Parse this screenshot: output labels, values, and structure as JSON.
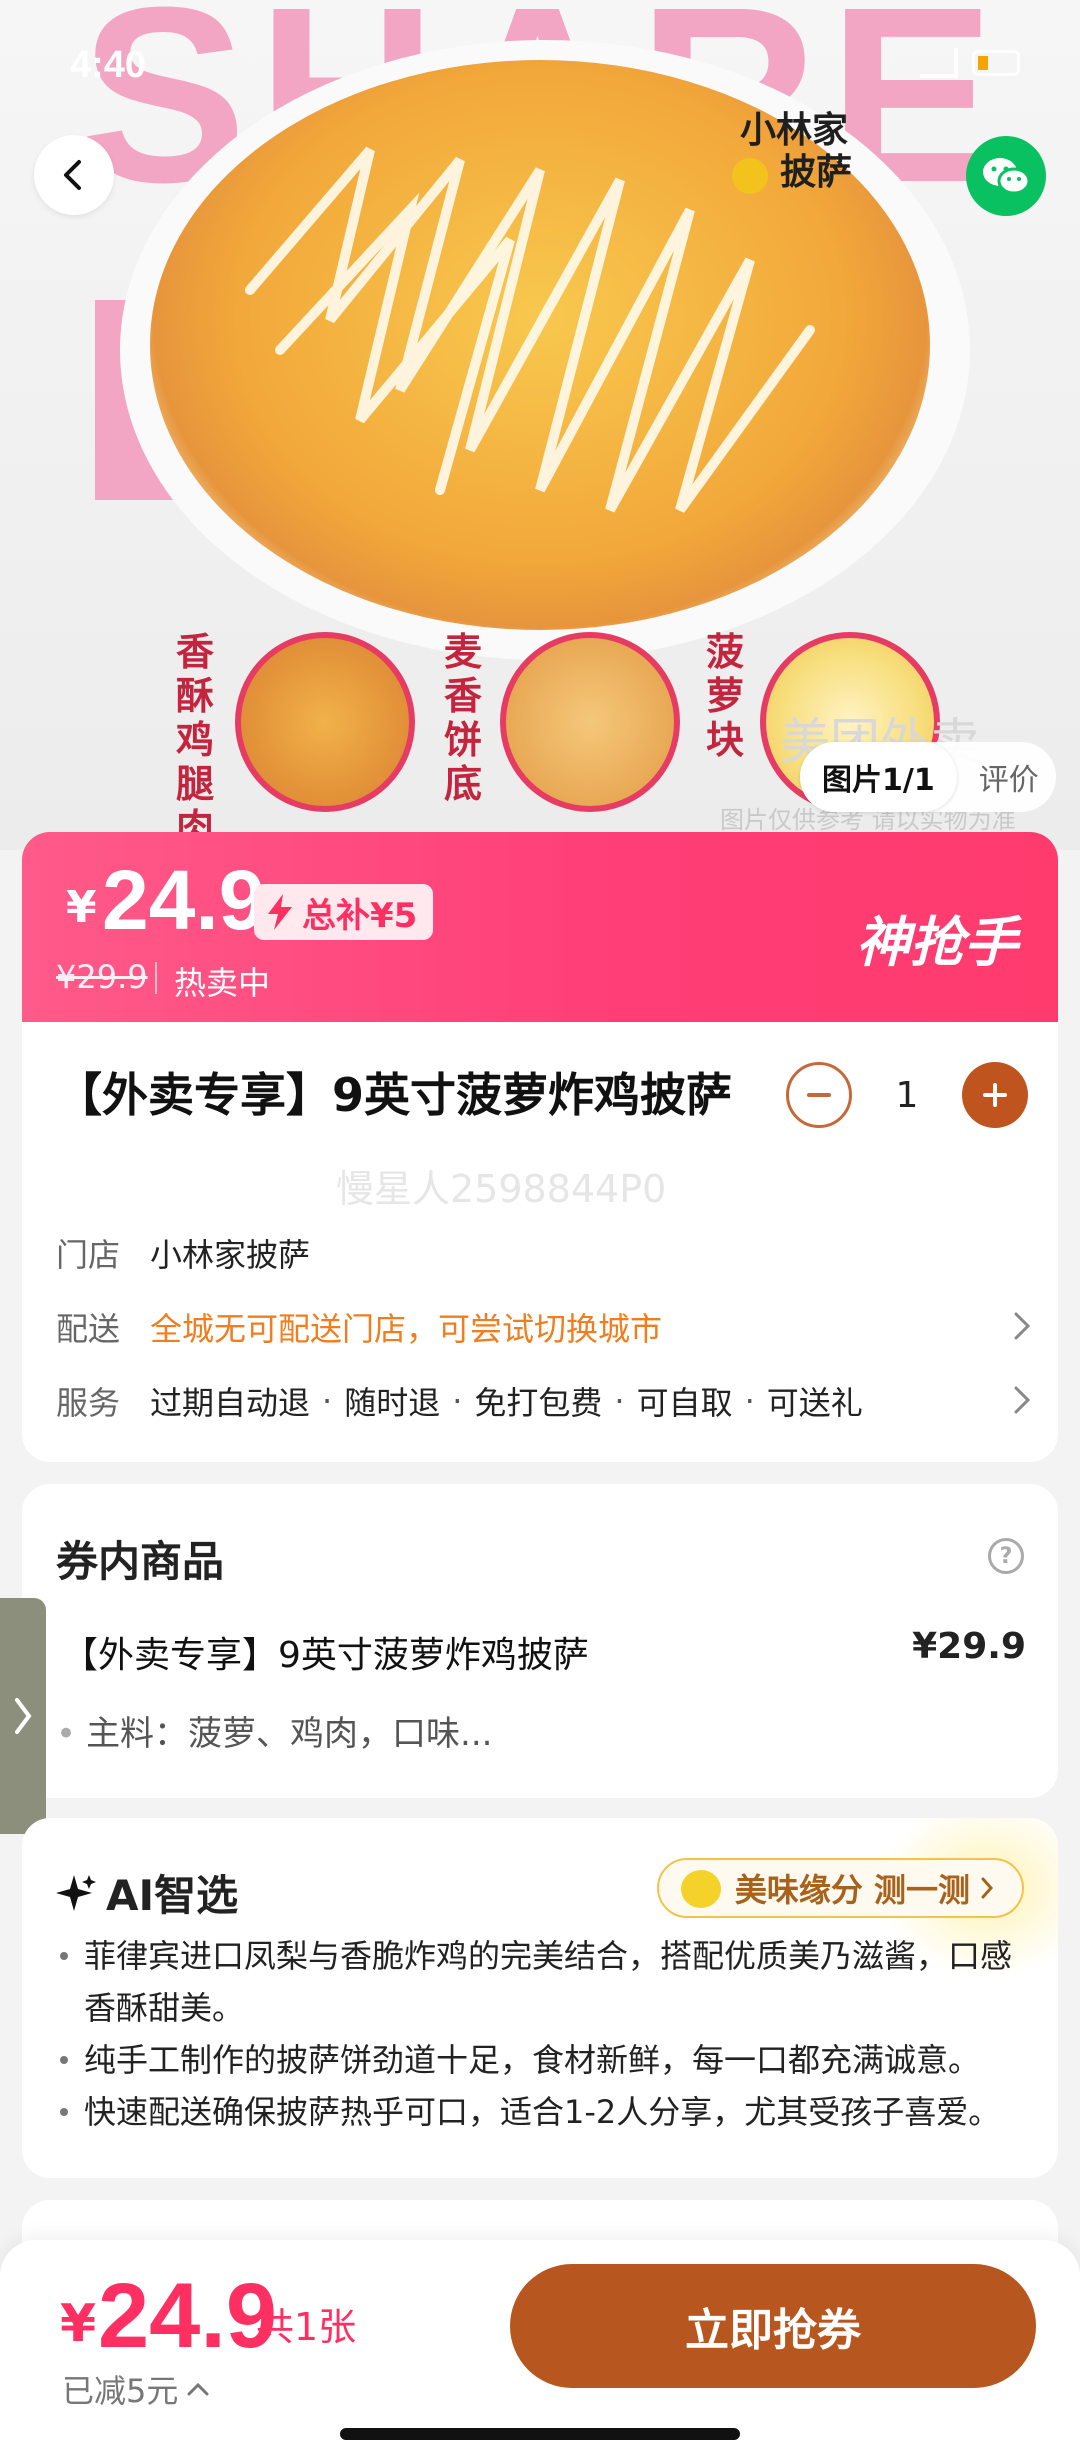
{
  "status_bar": {
    "time": "4:40"
  },
  "hero": {
    "background_word": "SHARE",
    "brand_line1": "小林家",
    "brand_line2": "披萨",
    "ingredients": [
      {
        "label": "香酥鸡腿肉"
      },
      {
        "label": "麦香饼底"
      },
      {
        "label": "菠萝块"
      }
    ],
    "image_counter": "图片1/1",
    "review_tab": "评价",
    "watermark_big": "美团外卖",
    "watermark_small": "图片仅供参考 请以实物为准"
  },
  "price": {
    "yen": "¥",
    "current": "24.9",
    "subsidy": "总补¥5",
    "original": "¥29.9",
    "status": "热卖中",
    "brand": "神抢手"
  },
  "product": {
    "title": "【外卖专享】9英寸菠萝炸鸡披萨",
    "quantity": "1",
    "watermark": "慢星人2598844P0",
    "store_key": "门店",
    "store_val": "小林家披萨",
    "delivery_key": "配送",
    "delivery_val": "全城无可配送门店，可尝试切换城市",
    "service_key": "服务",
    "services": [
      "过期自动退",
      "随时退",
      "免打包费",
      "可自取",
      "可送礼"
    ]
  },
  "coupon_items": {
    "title": "券内商品",
    "help": "?",
    "item_name": "【外卖专享】9英寸菠萝炸鸡披萨",
    "item_price": "¥29.9",
    "item_desc": "主料：菠萝、鸡肉，口味..."
  },
  "ai": {
    "title": "AI智选",
    "pill": "美味缘分 测一测",
    "bullets": [
      "菲律宾进口凤梨与香脆炸鸡的完美结合，搭配优质美乃滋酱，口感香酥甜美。",
      "纯手工制作的披萨饼劲道十足，食材新鲜，每一口都充满诚意。",
      "快速配送确保披萨热乎可口，适合1-2人分享，尤其受孩子喜爱。"
    ]
  },
  "bottom": {
    "yen": "¥",
    "price": "24.9",
    "count": "共1张",
    "saved": "已减5元",
    "cta": "立即抢券"
  },
  "colors": {
    "accent_pink": "#ff3d76",
    "cta_brown": "#b8561f",
    "warn_orange": "#f07d1e",
    "wechat_green": "#09c160"
  }
}
